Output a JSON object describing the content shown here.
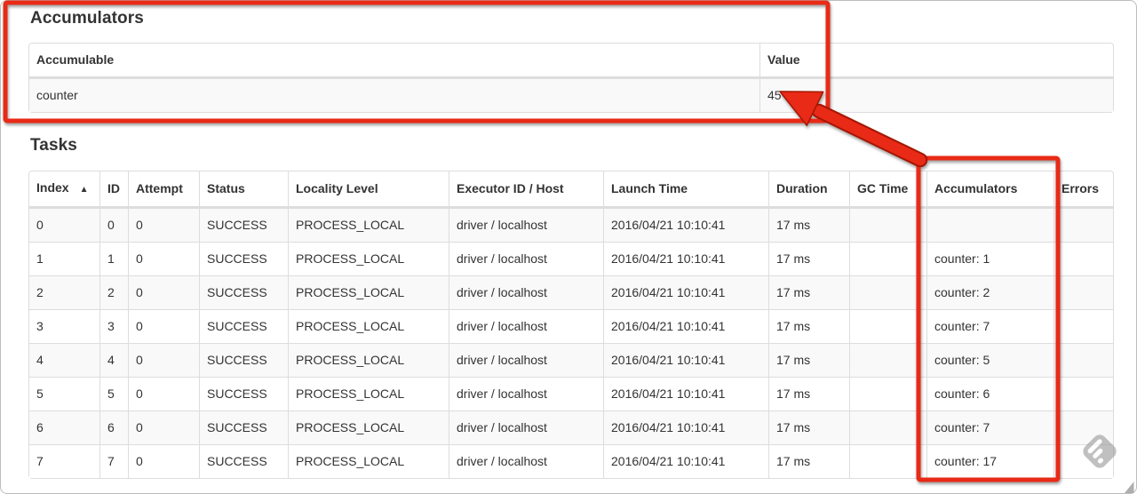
{
  "accumulators_section": {
    "heading": "Accumulators",
    "headers": {
      "accumulable": "Accumulable",
      "value": "Value"
    },
    "rows": [
      {
        "accumulable": "counter",
        "value": "45"
      }
    ]
  },
  "tasks_section": {
    "heading": "Tasks",
    "headers": {
      "index": "Index",
      "id": "ID",
      "attempt": "Attempt",
      "status": "Status",
      "locality": "Locality Level",
      "executor": "Executor ID / Host",
      "launch": "Launch Time",
      "duration": "Duration",
      "gc": "GC Time",
      "accumulators": "Accumulators",
      "errors": "Errors"
    },
    "sort_column": "Index",
    "sort_indicator": "▲",
    "rows": [
      {
        "index": "0",
        "id": "0",
        "attempt": "0",
        "status": "SUCCESS",
        "locality": "PROCESS_LOCAL",
        "executor": "driver / localhost",
        "launch": "2016/04/21 10:10:41",
        "duration": "17 ms",
        "gc": "",
        "accumulators": "",
        "errors": ""
      },
      {
        "index": "1",
        "id": "1",
        "attempt": "0",
        "status": "SUCCESS",
        "locality": "PROCESS_LOCAL",
        "executor": "driver / localhost",
        "launch": "2016/04/21 10:10:41",
        "duration": "17 ms",
        "gc": "",
        "accumulators": "counter: 1",
        "errors": ""
      },
      {
        "index": "2",
        "id": "2",
        "attempt": "0",
        "status": "SUCCESS",
        "locality": "PROCESS_LOCAL",
        "executor": "driver / localhost",
        "launch": "2016/04/21 10:10:41",
        "duration": "17 ms",
        "gc": "",
        "accumulators": "counter: 2",
        "errors": ""
      },
      {
        "index": "3",
        "id": "3",
        "attempt": "0",
        "status": "SUCCESS",
        "locality": "PROCESS_LOCAL",
        "executor": "driver / localhost",
        "launch": "2016/04/21 10:10:41",
        "duration": "17 ms",
        "gc": "",
        "accumulators": "counter: 7",
        "errors": ""
      },
      {
        "index": "4",
        "id": "4",
        "attempt": "0",
        "status": "SUCCESS",
        "locality": "PROCESS_LOCAL",
        "executor": "driver / localhost",
        "launch": "2016/04/21 10:10:41",
        "duration": "17 ms",
        "gc": "",
        "accumulators": "counter: 5",
        "errors": ""
      },
      {
        "index": "5",
        "id": "5",
        "attempt": "0",
        "status": "SUCCESS",
        "locality": "PROCESS_LOCAL",
        "executor": "driver / localhost",
        "launch": "2016/04/21 10:10:41",
        "duration": "17 ms",
        "gc": "",
        "accumulators": "counter: 6",
        "errors": ""
      },
      {
        "index": "6",
        "id": "6",
        "attempt": "0",
        "status": "SUCCESS",
        "locality": "PROCESS_LOCAL",
        "executor": "driver / localhost",
        "launch": "2016/04/21 10:10:41",
        "duration": "17 ms",
        "gc": "",
        "accumulators": "counter: 7",
        "errors": ""
      },
      {
        "index": "7",
        "id": "7",
        "attempt": "0",
        "status": "SUCCESS",
        "locality": "PROCESS_LOCAL",
        "executor": "driver / localhost",
        "launch": "2016/04/21 10:10:41",
        "duration": "17 ms",
        "gc": "",
        "accumulators": "counter: 17",
        "errors": ""
      }
    ]
  },
  "annotations": {
    "highlight_color": "#e82a16",
    "highlight_outline_color": "#a31505"
  },
  "icons": {
    "sort_ascending": "▲",
    "watermark": "feedly-icon"
  },
  "colors": {
    "row_stripe": "#f9f9f9",
    "table_border": "#dddddd",
    "text": "#333333"
  }
}
